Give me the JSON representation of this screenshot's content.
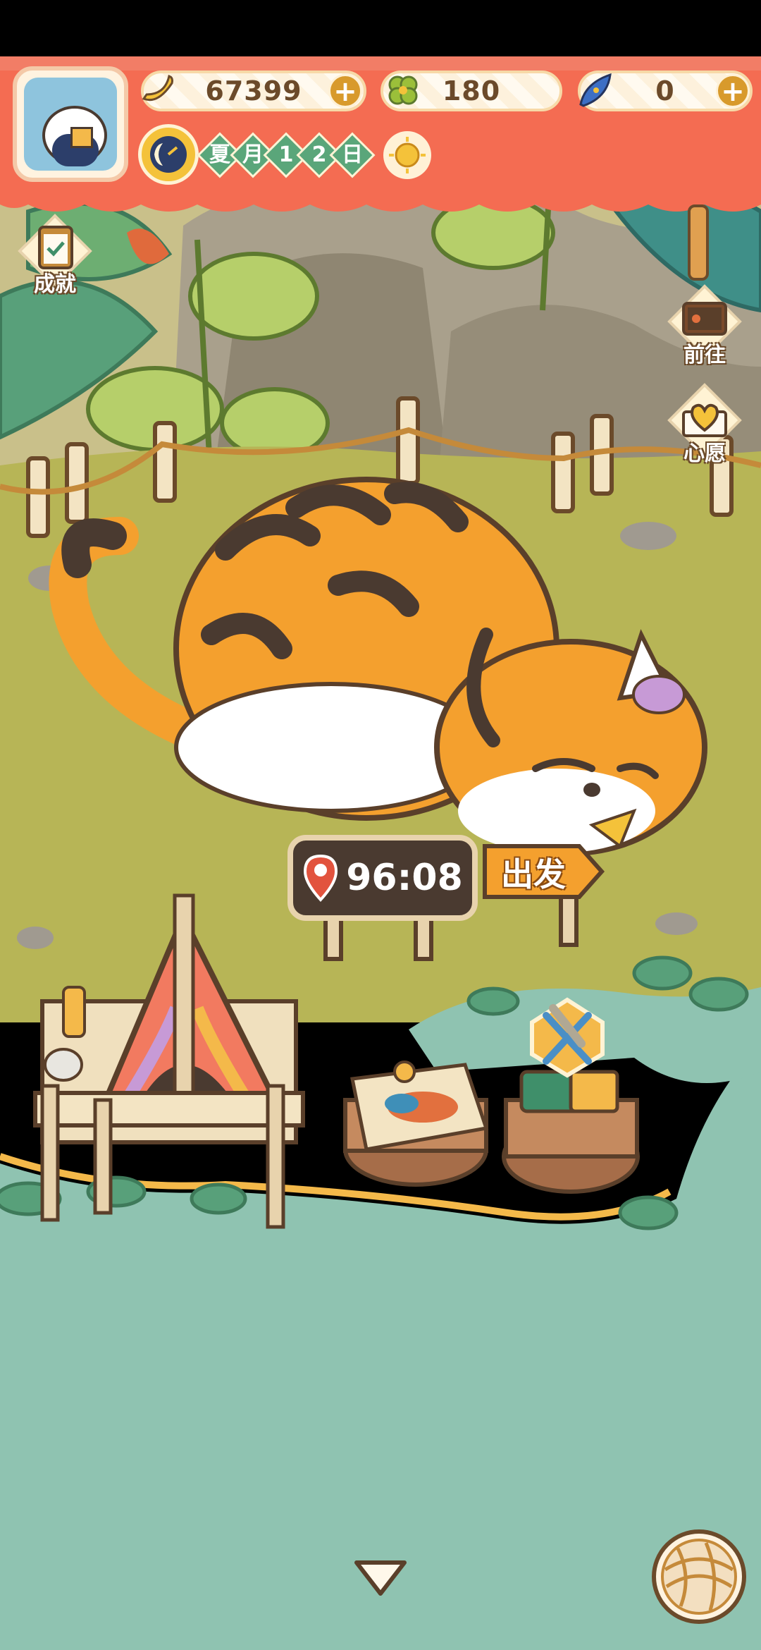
{
  "hud": {
    "banana_count": "67399",
    "clover_count": "180",
    "gem_count": "0",
    "date_chars": [
      "夏",
      "月",
      "1",
      "2",
      "日"
    ]
  },
  "side_buttons": {
    "achievements": "成就",
    "go": "前往",
    "wish": "心愿"
  },
  "travel": {
    "timer": "96:08",
    "depart": "出发"
  },
  "icons": {
    "avatar": "cat-avatar-icon",
    "banana": "banana-icon",
    "clover": "clover-icon",
    "gem": "feather-gem-icon",
    "moon": "moon-clock-icon",
    "weather": "sun-icon",
    "location": "location-pin-icon",
    "yarn": "yarn-ball-icon",
    "collapse": "chevron-down-icon"
  },
  "colors": {
    "header": "#f46c52",
    "grass": "#b7b556",
    "water": "#8fc3b1",
    "tiger": "#f4a02e"
  }
}
